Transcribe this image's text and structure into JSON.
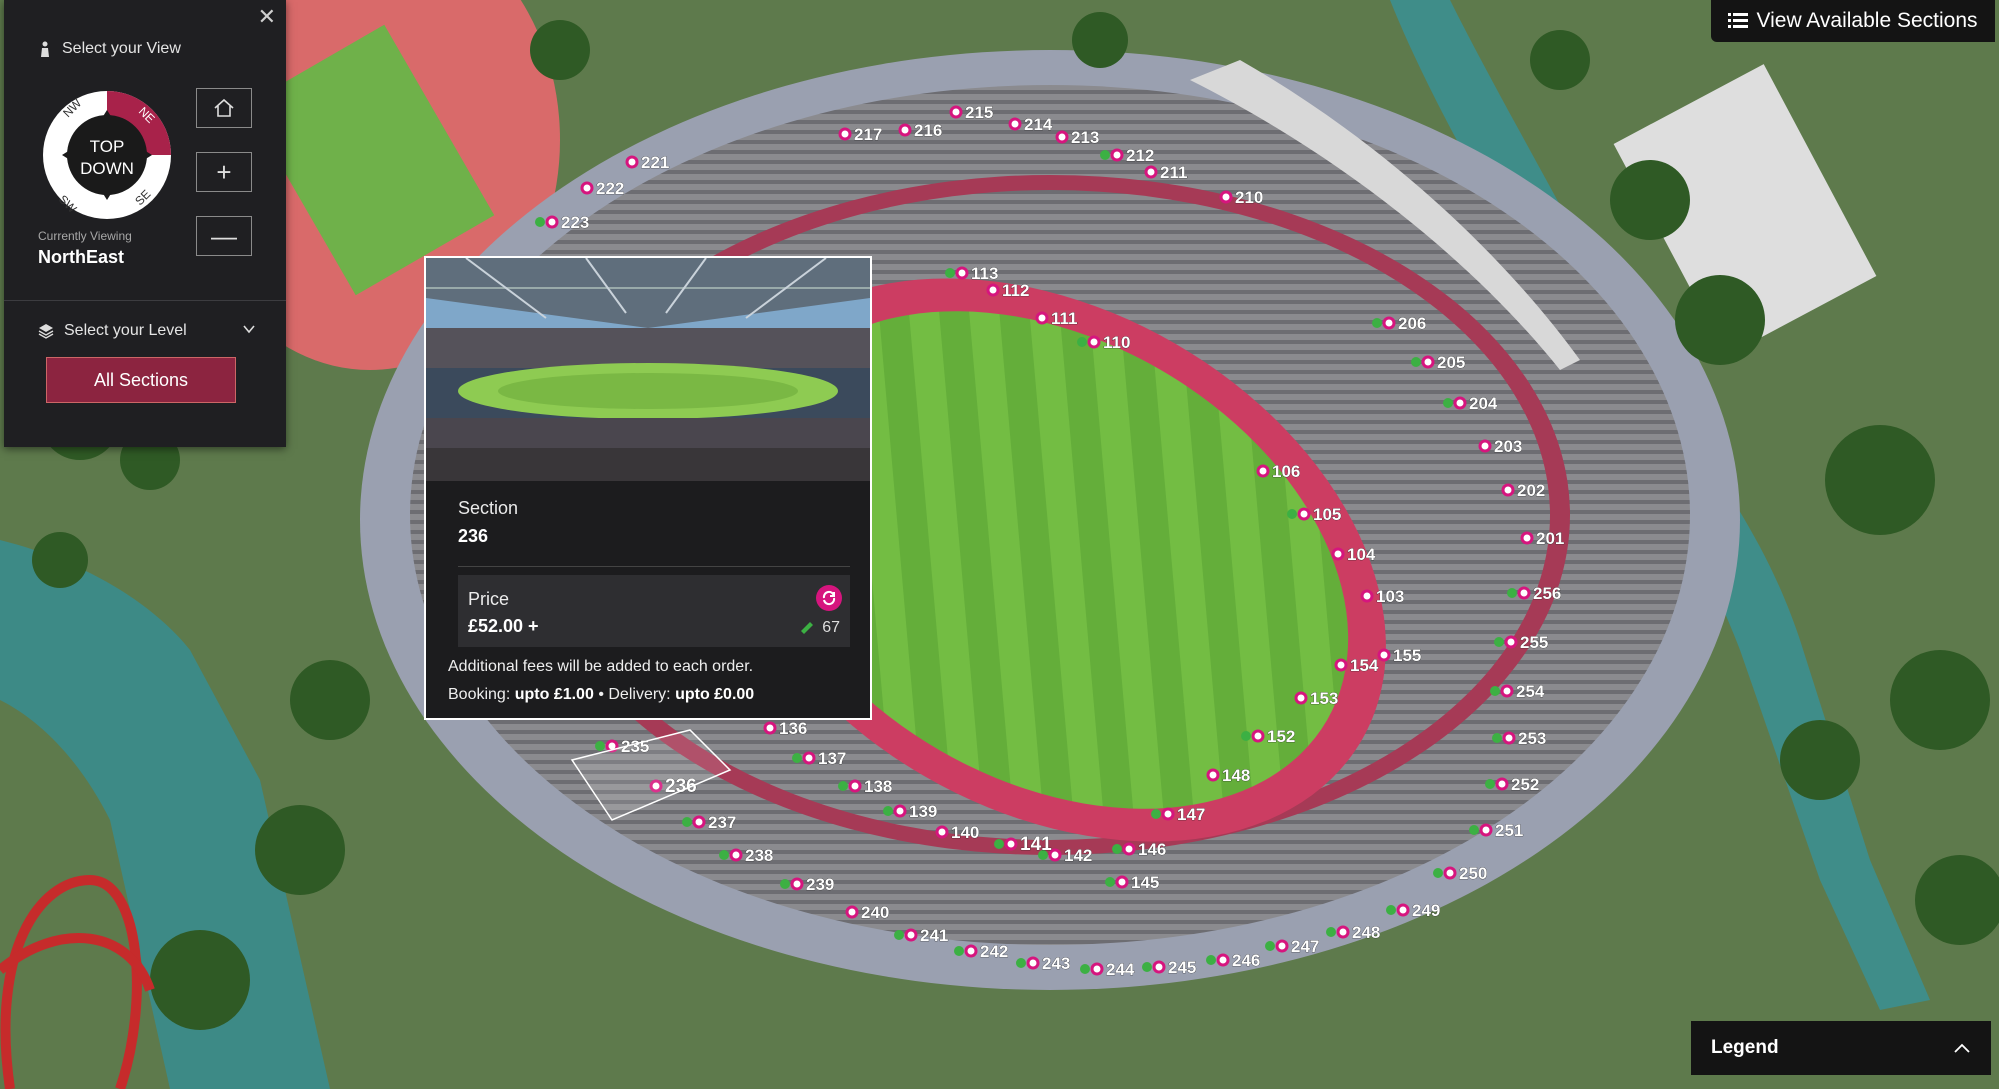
{
  "panel": {
    "select_view_label": "Select your View",
    "compass_center_line1": "TOP",
    "compass_center_line2": "DOWN",
    "compass_nw": "NW",
    "compass_ne": "NE",
    "compass_sw": "SW",
    "compass_se": "SE",
    "currently_viewing_caption": "Currently Viewing",
    "currently_viewing_value": "NorthEast",
    "select_level_label": "Select your Level",
    "all_sections_label": "All Sections",
    "zoom_in_label": "+",
    "zoom_out_label": "—"
  },
  "header": {
    "view_sections_label": "View Available Sections"
  },
  "legend": {
    "label": "Legend"
  },
  "popup": {
    "section_caption": "Section",
    "section_value": "236",
    "price_caption": "Price",
    "price_value": "£52.00 +",
    "ticket_count": "67",
    "fees_line": "Additional fees will be added to each order.",
    "booking_caption": "Booking:",
    "booking_value": "upto £1.00",
    "bullet": "•",
    "delivery_caption": "Delivery:",
    "delivery_value": "upto £0.00"
  },
  "colors": {
    "accent": "#d6157e",
    "available": "#3cb043",
    "button_primary": "#8c2440",
    "panel_bg": "#1f1f22"
  },
  "sections": [
    "217",
    "216",
    "215",
    "214",
    "213",
    "212",
    "211",
    "210",
    "221",
    "222",
    "223",
    "113",
    "112",
    "111",
    "110",
    "206",
    "205",
    "204",
    "203",
    "202",
    "201",
    "106",
    "105",
    "104",
    "103",
    "256",
    "255",
    "254",
    "253",
    "252",
    "251",
    "250",
    "155",
    "154",
    "153",
    "152",
    "148",
    "147",
    "146",
    "145",
    "142",
    "141",
    "140",
    "139",
    "138",
    "137",
    "136",
    "235",
    "236",
    "237",
    "238",
    "239",
    "240",
    "241",
    "242",
    "243",
    "244",
    "245",
    "246",
    "247",
    "248",
    "249"
  ]
}
